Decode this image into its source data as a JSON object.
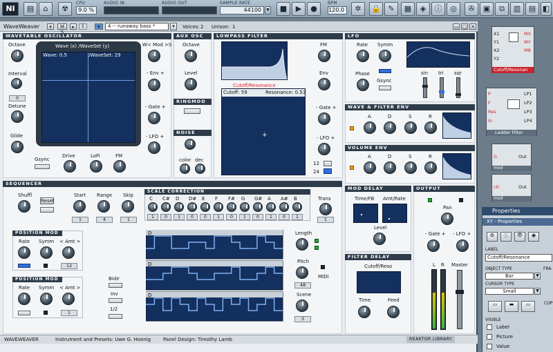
{
  "toolbar": {
    "cpu_label": "CPU",
    "cpu_value": "9.0 %",
    "audio_in_label": "AUDIO IN",
    "audio_out_label": "AUDIO OUT",
    "sample_rate_label": "SAMPLE RATE",
    "sample_rate_value": "44100",
    "bpm_label": "BPM",
    "bpm_value": "120.0"
  },
  "instrument": {
    "name": "WaveWeaver",
    "number": "1",
    "preset": "4 -- runaway bass *",
    "voices_label": "Voices:",
    "voices_value": "2",
    "unison_label": "Unison:",
    "unison_value": "1"
  },
  "sections": {
    "wavetable": "WAVETABLE OSCILLATOR",
    "aux": "AUX OSC",
    "lowpass": "LOWPASS FILTER",
    "lfo": "LFO",
    "ringmod": "RINGMOD",
    "noise": "NOISE",
    "wave_filter_env": "WAVE & FILTER ENV",
    "volume_env": "VOLUME ENV",
    "sequencer": "SEQUENCER",
    "scale": "SCALE CORRECTION",
    "mod_delay": "MOD DELAY",
    "output": "OUTPUT",
    "filter_delay": "FILTER DELAY",
    "pos_mod1": "POSITION MOD 1",
    "pos_mod2": "POSITION MOD 2"
  },
  "wavetable": {
    "octave": "Octave",
    "interval": "Interval",
    "interval_val": "0",
    "detune": "Detune",
    "glide": "Glide",
    "gsync": "Gsync",
    "drive": "Drive",
    "lofi": "LoFi",
    "fm": "FM",
    "display_title": "Wave (x) /WaveSet (y)",
    "wave_label": "Wave: 0.5",
    "waveset_label": "/WaveSet: 29",
    "wmod": "W< Mod >S",
    "env": "- Env +",
    "gate": "- Gate +",
    "lfo": "- LFO +"
  },
  "aux": {
    "octave": "Octave",
    "level": "Level",
    "color": "color",
    "dec": "dec"
  },
  "filter": {
    "fm": "FM",
    "env": "Env",
    "gate": "- Gate +",
    "lfo": "- LFO +",
    "xy_label": "Cutoff/Resonance",
    "cutoff": "Cutoff: 59",
    "resonance": "Resonance: 0.53",
    "slope12": "12",
    "slope24": "24"
  },
  "lfo": {
    "rate": "Rate",
    "symm": "Symm",
    "phase": "Phase",
    "gsync": "Gsync",
    "sin": "sin",
    "tri": "tri",
    "sqr": "sqr"
  },
  "env": {
    "a": "A",
    "d": "D",
    "s": "S",
    "r": "R"
  },
  "sequencer": {
    "shuffl": "Shuffl",
    "reset": "Reset",
    "start": "Start",
    "range": "Range",
    "skip": "Skip",
    "start_val": "1",
    "range_val": "4",
    "skip_val": "1",
    "trans": "Trans",
    "trans_val": "1",
    "notes": [
      "C",
      "C#",
      "D",
      "D#",
      "E",
      "F",
      "F#",
      "G",
      "G#",
      "A",
      "A#",
      "B"
    ],
    "note_vals": [
      "1",
      "0",
      "1",
      "0",
      "0",
      "1",
      "0",
      "1",
      "0",
      "1",
      "0",
      "1"
    ],
    "rate": "Rate",
    "symm": "Symm",
    "amt": "< Amt >",
    "amt1_val": "12",
    "amt2_val": "1",
    "bidir": "Bidir",
    "inv": "Inv",
    "half": "1/2",
    "length": "Length",
    "pitch": "Pitch",
    "pitch_val": "48",
    "midi": "MIDI",
    "scene": "Scene",
    "scene_val": "3",
    "lane_d": "D"
  },
  "moddelay": {
    "time_fb": "Time/FB",
    "amt_rate": "Amt/Rate",
    "level": "Level"
  },
  "output": {
    "pan": "Pan",
    "gate": "- Gate +",
    "lfo": "- LFO +",
    "l": "L",
    "r": "R",
    "master": "Master"
  },
  "filterdelay": {
    "cutoff_reso": "Cutoff/Reso",
    "time": "Time",
    "feed": "Feed"
  },
  "footer": {
    "name": "WAVEWEAVER",
    "credit1": "Instrument and Presets: Uwe G. Hoenig",
    "credit2": "Panel Design: Timothy Lamb",
    "logo": "REAKTOR LIBRARY"
  },
  "editor": {
    "xy_ports": [
      "X1",
      "Y1",
      "X2",
      "Y2"
    ],
    "xy_out": [
      "MX",
      "MY",
      "MB"
    ],
    "xy_title": "Cutoff/Resonan",
    "ladder_in": [
      "P",
      "F",
      "Res",
      "In"
    ],
    "ladder_out": [
      "LP1",
      "LP2",
      "LP3",
      "LP4"
    ],
    "ladder_title": "Ladder Filter",
    "mod1_in": "G",
    "mod1_out": "Out",
    "mod2_in": "ctl",
    "mod2_out": "Out",
    "mod_title": "mod"
  },
  "props": {
    "title": "Properties",
    "subtitle": "XY - Properties",
    "label_hdr": "LABEL",
    "label_value": "Cutoff/Resonance",
    "object_type": "OBJECT TYPE",
    "object_val": "Bar",
    "cursor_type": "CURSOR TYPE",
    "cursor_val": "Small",
    "visible": "VISIBLE",
    "opt_label": "Label",
    "opt_picture": "Picture",
    "opt_value": "Value",
    "fra": "FRA",
    "cop": "COP"
  },
  "colors": {
    "display_blue": "#14305e",
    "header": "#2e3c4a",
    "accent_blue": "#2f6fe0",
    "orange": "#f5a000",
    "red_title": "#e0202a"
  }
}
